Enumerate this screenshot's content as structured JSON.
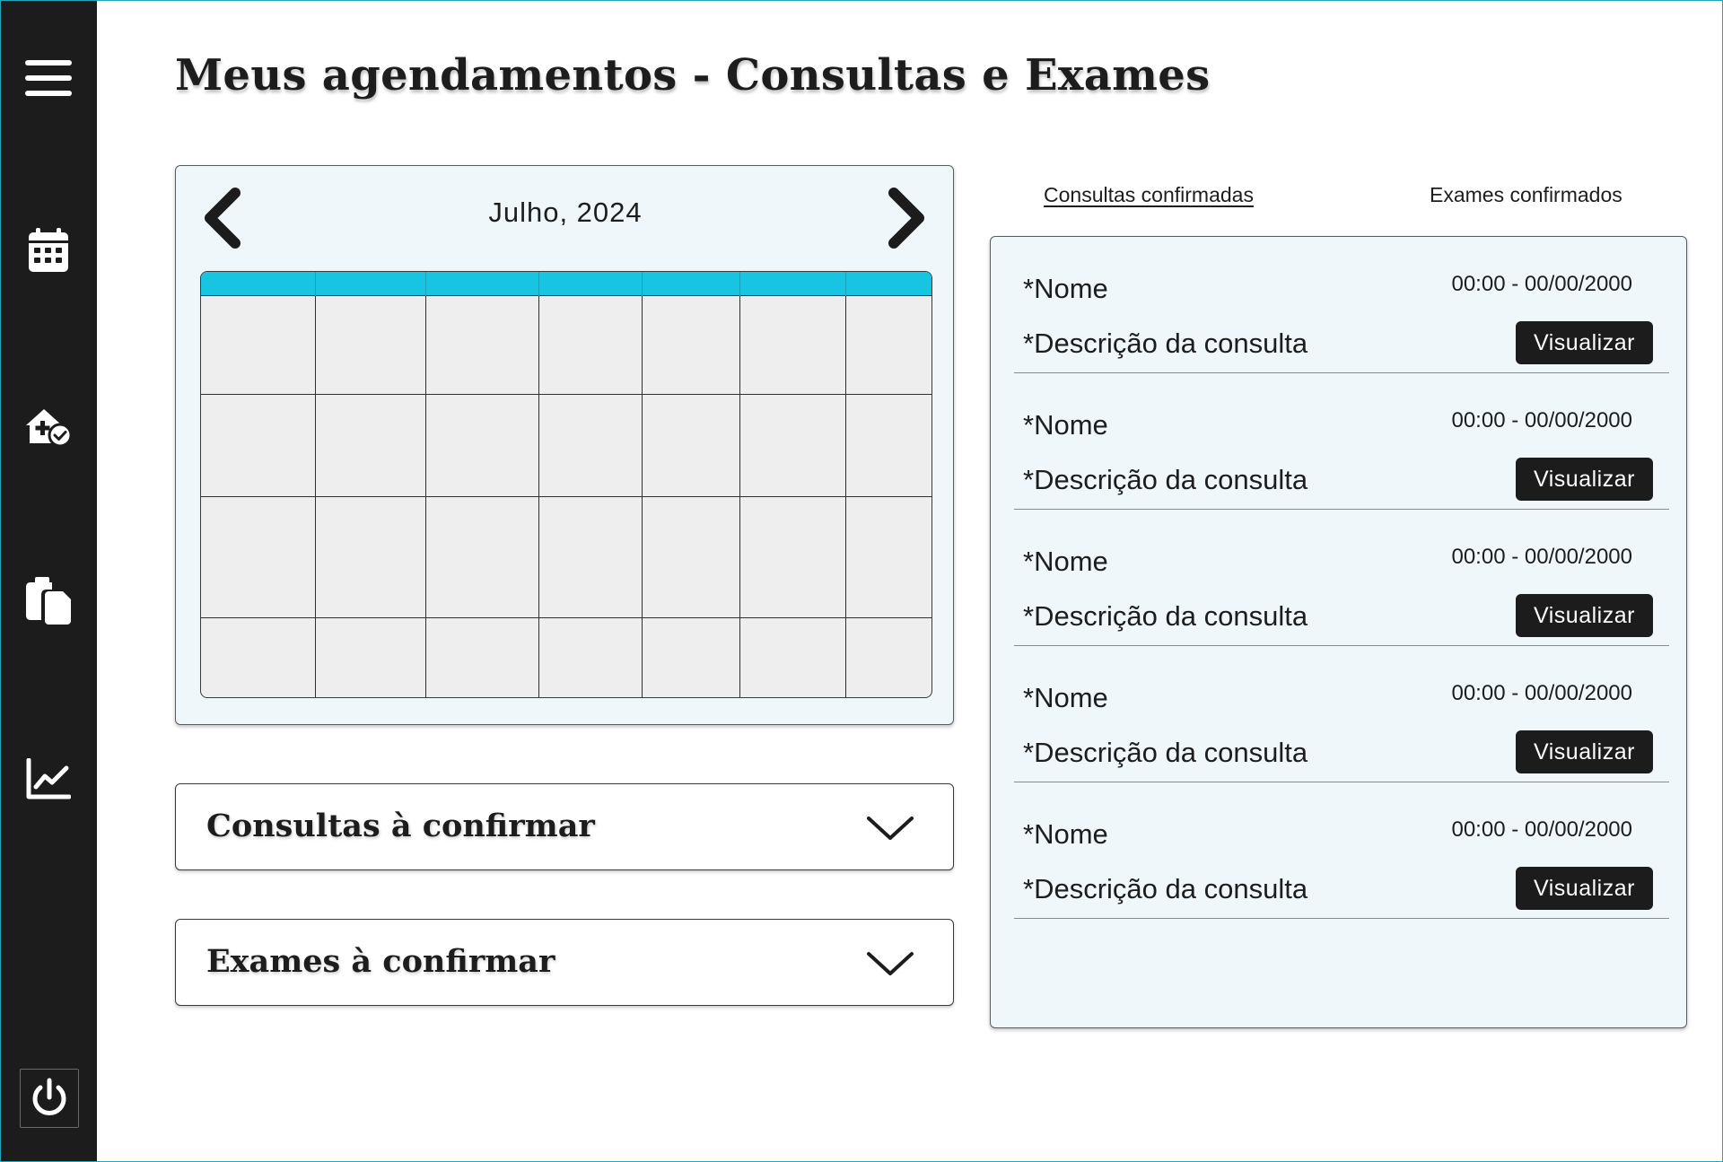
{
  "page_title": "Meus agendamentos - Consultas e Exames",
  "sidebar": {
    "items": [
      {
        "name": "menu",
        "icon": "hamburger-menu-icon"
      },
      {
        "name": "agenda",
        "icon": "calendar-icon"
      },
      {
        "name": "consultas",
        "icon": "clinic-check-icon"
      },
      {
        "name": "exames",
        "icon": "clipboard-icon"
      },
      {
        "name": "estatisticas",
        "icon": "line-chart-icon"
      }
    ],
    "logout_icon": "power-icon",
    "background": "#1c1c1c"
  },
  "calendar": {
    "month_label": "Julho, 2024",
    "prev_icon": "chevron-left-icon",
    "next_icon": "chevron-right-icon",
    "header_color": "#17c4e2",
    "columns": 7,
    "rows": 4
  },
  "accordions": [
    {
      "label": "Consultas à confirmar",
      "icon": "chevron-down-icon"
    },
    {
      "label": "Exames à confirmar",
      "icon": "chevron-down-icon"
    }
  ],
  "tabs": [
    {
      "label": "Consultas confirmadas",
      "active": true
    },
    {
      "label": "Exames confirmados",
      "active": false
    }
  ],
  "appointments": [
    {
      "name": "*Nome",
      "description": "*Descrição da consulta",
      "datetime": "00:00 - 00/00/2000",
      "button_label": "Visualizar"
    },
    {
      "name": "*Nome",
      "description": "*Descrição da consulta",
      "datetime": "00:00 - 00/00/2000",
      "button_label": "Visualizar"
    },
    {
      "name": "*Nome",
      "description": "*Descrição da consulta",
      "datetime": "00:00 - 00/00/2000",
      "button_label": "Visualizar"
    },
    {
      "name": "*Nome",
      "description": "*Descrição da consulta",
      "datetime": "00:00 - 00/00/2000",
      "button_label": "Visualizar"
    },
    {
      "name": "*Nome",
      "description": "*Descrição da consulta",
      "datetime": "00:00 - 00/00/2000",
      "button_label": "Visualizar"
    }
  ]
}
